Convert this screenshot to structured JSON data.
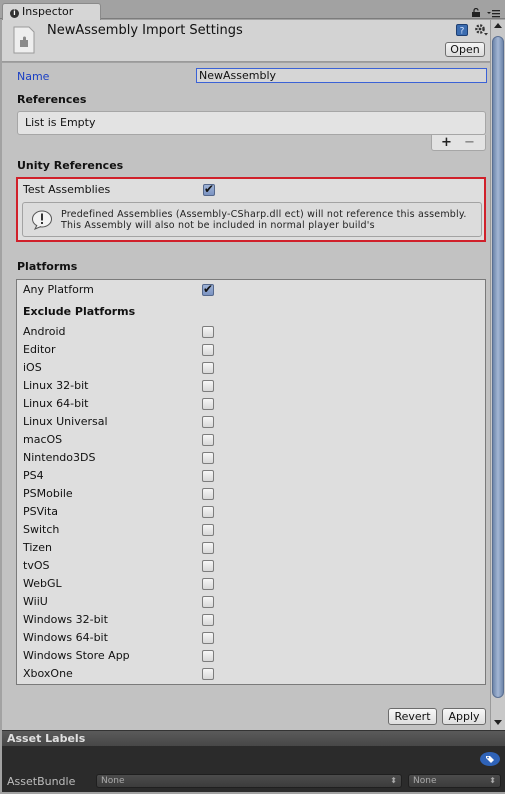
{
  "tab": {
    "label": "Inspector"
  },
  "header": {
    "title": "NewAssembly Import Settings",
    "open_label": "Open"
  },
  "name_field": {
    "label": "Name",
    "value": "NewAssembly"
  },
  "references": {
    "title": "References",
    "empty_text": "List is Empty",
    "add_label": "+",
    "remove_label": "−"
  },
  "unity_references": {
    "title": "Unity References",
    "test_assemblies": {
      "label": "Test Assemblies",
      "checked": true
    },
    "help_line1": "Predefined Assemblies (Assembly-CSharp.dll ect) will not reference this assembly.",
    "help_line2": "This Assembly will also not be included in normal player build's"
  },
  "platforms": {
    "title": "Platforms",
    "any_platform": {
      "label": "Any Platform",
      "checked": true
    },
    "exclude_title": "Exclude Platforms",
    "items": [
      {
        "label": "Android",
        "checked": false
      },
      {
        "label": "Editor",
        "checked": false
      },
      {
        "label": "iOS",
        "checked": false
      },
      {
        "label": "Linux 32-bit",
        "checked": false
      },
      {
        "label": "Linux 64-bit",
        "checked": false
      },
      {
        "label": "Linux Universal",
        "checked": false
      },
      {
        "label": "macOS",
        "checked": false
      },
      {
        "label": "Nintendo3DS",
        "checked": false
      },
      {
        "label": "PS4",
        "checked": false
      },
      {
        "label": "PSMobile",
        "checked": false
      },
      {
        "label": "PSVita",
        "checked": false
      },
      {
        "label": "Switch",
        "checked": false
      },
      {
        "label": "Tizen",
        "checked": false
      },
      {
        "label": "tvOS",
        "checked": false
      },
      {
        "label": "WebGL",
        "checked": false
      },
      {
        "label": "WiiU",
        "checked": false
      },
      {
        "label": "Windows 32-bit",
        "checked": false
      },
      {
        "label": "Windows 64-bit",
        "checked": false
      },
      {
        "label": "Windows Store App",
        "checked": false
      },
      {
        "label": "XboxOne",
        "checked": false
      }
    ]
  },
  "actions": {
    "revert_label": "Revert",
    "apply_label": "Apply"
  },
  "asset_labels": {
    "title": "Asset Labels",
    "asset_bundle_label": "AssetBundle",
    "bundle_name": "None",
    "bundle_variant": "None"
  },
  "colors": {
    "highlight_border": "#d0202a",
    "name_label": "#1a3fc4",
    "scroll_thumb": "#8aa0c4"
  }
}
